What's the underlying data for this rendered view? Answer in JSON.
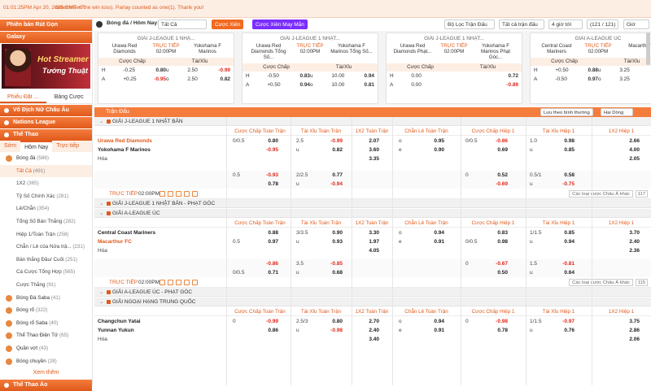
{
  "topbar": {
    "time": "01:01:25PM Apr 20, 2025 GMT +7",
    "marquee": "determined the win loss). Parlay counted as one(1). Thank you!"
  },
  "sidebar": {
    "wallet": "Phiên bản Rút Gọn",
    "galaxy": "Galaxy",
    "banner_line1": "Hot Streamer",
    "banner_line2": "Tướng Thuật",
    "tabs": [
      "Phiếu Đặt ...",
      "Bảng Cược"
    ],
    "sections": [
      "Vô Địch Nữ Châu Âu",
      "Nations League",
      "Thể Thao"
    ],
    "sport_tabs": [
      "Sớm",
      "Hôm Nay",
      "Trực tiếp"
    ],
    "items": [
      {
        "label": "Bóng đá",
        "count": "(586)"
      },
      {
        "label": "Tất Cả",
        "count": "(491)"
      },
      {
        "label": "1X2",
        "count": "(365)"
      },
      {
        "label": "Tỷ Số Chính Xác",
        "count": "(281)"
      },
      {
        "label": "Lẻ/Chẵn",
        "count": "(354)"
      },
      {
        "label": "Tổng Số Bàn Thắng",
        "count": "(282)"
      },
      {
        "label": "Hiệp 1/Toàn Trận",
        "count": "(258)"
      },
      {
        "label": "Chẵn / Lẻ của Nửa trậ...",
        "count": "(231)"
      },
      {
        "label": "Bàn thắng Đầu/ Cuối",
        "count": "(251)"
      },
      {
        "label": "Cá Cược Tổng Hợp",
        "count": "(565)"
      },
      {
        "label": "Cược Thắng",
        "count": "(91)"
      },
      {
        "label": "Bóng Đá Saba",
        "count": "(41)"
      },
      {
        "label": "Bóng rổ",
        "count": "(322)"
      },
      {
        "label": "Bóng rổ Saba",
        "count": "(40)"
      },
      {
        "label": "Thể Thao Điện Tử",
        "count": "(65)"
      },
      {
        "label": "Quần vợt",
        "count": "(43)"
      },
      {
        "label": "Bóng chuyền",
        "count": "(28)"
      }
    ],
    "more": "Xem thêm",
    "footer": "Thể Thao Ảo"
  },
  "toolbar": {
    "title": "Bóng đá / Hôm Nay",
    "filter": "Tất Cả",
    "live": "Cược Xiên",
    "mix": "Cược Xiên May Mắn",
    "league_filter": "Bộ Lọc Trận Đấu",
    "all_matches": "Tất cả trận đấu",
    "time": "4 giờ tới",
    "count": "(121 / 121)",
    "mode": "Giờ"
  },
  "cards": [
    {
      "league": "GIẢI J-LEAGUE 1 NHẬ...",
      "home": "Urawa Red Diamonds",
      "away": "Yokohama F Marinos",
      "status": "TRỰC TIẾP",
      "time": "02:00PM",
      "h": [
        "H",
        "-0.25",
        "0.80",
        "u",
        "2.50",
        "-0.99"
      ],
      "a": [
        "A",
        "+0.25",
        "-0.95",
        "o",
        "2.50",
        "0.82"
      ]
    },
    {
      "league": "GIẢI J-LEAGUE 1 NHẬT...",
      "home": "Urawa Red Diamonds Tổng Số...",
      "away": "Yokohama F Marinos Tổng Số...",
      "status": "TRỰC TIẾP",
      "time": "02:00PM",
      "h": [
        "H",
        "-0.50",
        "0.83",
        "u",
        "10.00",
        "0.94"
      ],
      "a": [
        "A",
        "+0.50",
        "0.94",
        "o",
        "10.00",
        "0.81"
      ]
    },
    {
      "league": "GIẢI J-LEAGUE 1 NHẬT...",
      "home": "Urawa Red Diamonds Phạt...",
      "away": "Yokohama F Marinos Phạt Góc...",
      "status": "TRỰC TIẾP",
      "time": "02:00PM",
      "h": [
        "H",
        "0.00",
        "",
        "",
        "",
        "0.72"
      ],
      "a": [
        "A",
        "0.00",
        "",
        "",
        "",
        "-0.89"
      ]
    },
    {
      "league": "GIẢI A-LEAGUE ÚC",
      "home": "Central Coast Mariners",
      "away": "Macarthur",
      "status": "TRỰC TIẾP",
      "time": "02:00PM",
      "h": [
        "H",
        "+0.50",
        "0.88",
        "u",
        "3.25",
        ""
      ],
      "a": [
        "A",
        "-0.50",
        "0.97",
        "o",
        "3.25",
        ""
      ]
    }
  ],
  "card_headers": {
    "hdp": "Cược Chấp",
    "ou": "Tài/Xỉu"
  },
  "table": {
    "bar_label": "Trận Đấu",
    "sort_label": "Lưu theo bình thường",
    "odds_type": "Hai Dòng",
    "cols": [
      "Cược Chấp Toàn Trận",
      "Tài Xỉu Toàn Trận",
      "1X2 Toàn Trận",
      "Chẵn Lẻ Toàn Trận",
      "Cược Chấp Hiệp 1",
      "Tài Xỉu Hiệp 1",
      "1X2 Hiệp 1"
    ],
    "draw": "Hòa",
    "live": "TRỰC TIẾP",
    "kickoff": "02:00PM",
    "other_bets": "Các loại cược Châu Á khác",
    "leagues": [
      "GIẢI J-LEAGUE 1 NHẬT BẢN",
      "GIẢI J-LEAGUE 1 NHẬT BẢN - PHẠT GÓC",
      "GIẢI A-LEAGUE ÚC",
      "GIẢI A-LEAGUE ÚC - PHẠT GÓC",
      "GIẢI NGOẠI HẠNG TRUNG QUỐC"
    ],
    "match1": {
      "home": "Urawa Red Diamonds",
      "away": "Yokohama F Marinos",
      "more": "117",
      "r1": [
        "0/0.5",
        "0.80",
        "2.5",
        "-0.99",
        "2.07",
        "o",
        "0.95",
        "0/0.5",
        "-0.86",
        "1.0",
        "0.98",
        "2.66"
      ],
      "r2": [
        "",
        "-0.95",
        "u",
        "0.82",
        "3.60",
        "e",
        "0.90",
        "",
        "0.69",
        "u",
        "0.85",
        "4.00"
      ],
      "r3": [
        "",
        "",
        "",
        "",
        "3.35",
        "",
        "",
        "",
        "",
        "",
        "",
        "2.05"
      ],
      "r4": [
        "0.5",
        "-0.93",
        "2/2.5",
        "0.77",
        "",
        "",
        "",
        "0",
        "0.52",
        "0.5/1",
        "0.58",
        ""
      ],
      "r5": [
        "",
        "0.78",
        "u",
        "-0.94",
        "",
        "",
        "",
        "",
        "-0.69",
        "u",
        "-0.75",
        ""
      ]
    },
    "match2": {
      "home": "Central Coast Mariners",
      "away": "Macarthur FC",
      "more": "115",
      "r1": [
        "",
        "0.88",
        "3/3.5",
        "0.90",
        "3.30",
        "o",
        "0.94",
        "",
        "0.83",
        "1/1.5",
        "0.85",
        "3.70"
      ],
      "r2": [
        "0.5",
        "0.97",
        "u",
        "0.93",
        "1.97",
        "e",
        "0.91",
        "0/0.5",
        "0.98",
        "u",
        "0.94",
        "2.40"
      ],
      "r3": [
        "",
        "",
        "",
        "",
        "4.05",
        "",
        "",
        "",
        "",
        "",
        "",
        "2.36"
      ],
      "r4": [
        "",
        "-0.86",
        "3.5",
        "-0.85",
        "",
        "",
        "",
        "0",
        "-0.67",
        "1.5",
        "-0.81",
        ""
      ],
      "r5": [
        "0/0.5",
        "0.71",
        "u",
        "0.68",
        "",
        "",
        "",
        "",
        "0.50",
        "u",
        "0.64",
        ""
      ]
    },
    "match3": {
      "home": "Changchun Yatai",
      "away": "Yunnan Yukun",
      "r1": [
        "0",
        "-0.99",
        "2.5/3",
        "0.80",
        "2.70",
        "o",
        "0.94",
        "0",
        "-0.98",
        "1/1.5",
        "-0.97",
        "3.75"
      ],
      "r2": [
        "",
        "0.86",
        "u",
        "-0.98",
        "2.40",
        "e",
        "0.91",
        "",
        "0.78",
        "u",
        "0.76",
        "2.86"
      ],
      "r3": [
        "",
        "",
        "",
        "",
        "3.40",
        "",
        "",
        "",
        "",
        "",
        "",
        "2.06"
      ]
    }
  }
}
